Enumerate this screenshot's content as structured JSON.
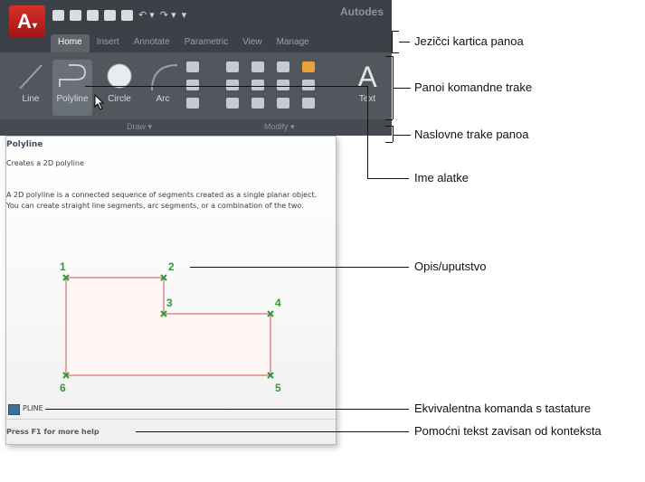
{
  "window": {
    "app_logo": "A",
    "title": "Autodes",
    "tabs": [
      "Home",
      "Insert",
      "Annotate",
      "Parametric",
      "View",
      "Manage"
    ],
    "active_tab": "Home",
    "tools": {
      "line": "Line",
      "polyline": "Polyline",
      "circle": "Circle",
      "arc": "Arc",
      "text": "Text"
    },
    "panels": [
      "Draw ▾",
      "Modify ▾"
    ]
  },
  "tooltip": {
    "title": "Polyline",
    "subtitle": "Creates a 2D polyline",
    "description": "A 2D polyline is a connected sequence of segments created as a single planar object. You can create straight line segments, arc segments, or a combination of the two.",
    "points": [
      "1",
      "2",
      "3",
      "4",
      "5",
      "6"
    ],
    "command_icon": "command-line-icon",
    "command": "PLINE",
    "help": "Press F1 for more help"
  },
  "callouts": {
    "tab_labels": "Jezičci kartica panoa",
    "ribbon_panels": "Panoi komandne trake",
    "panel_titles": "Naslovne trake panoa",
    "tool_name": "Ime alatke",
    "description": "Opis/uputstvo",
    "keyboard_command": "Ekvivalentna komanda s tastature",
    "context_help": "Pomoćni tekst zavisan od konteksta"
  },
  "colors": {
    "app_button": "#c8201c",
    "ribbon": "#52565d",
    "polyline_stroke": "#e0878a",
    "point_marker": "#2f9a3a"
  }
}
